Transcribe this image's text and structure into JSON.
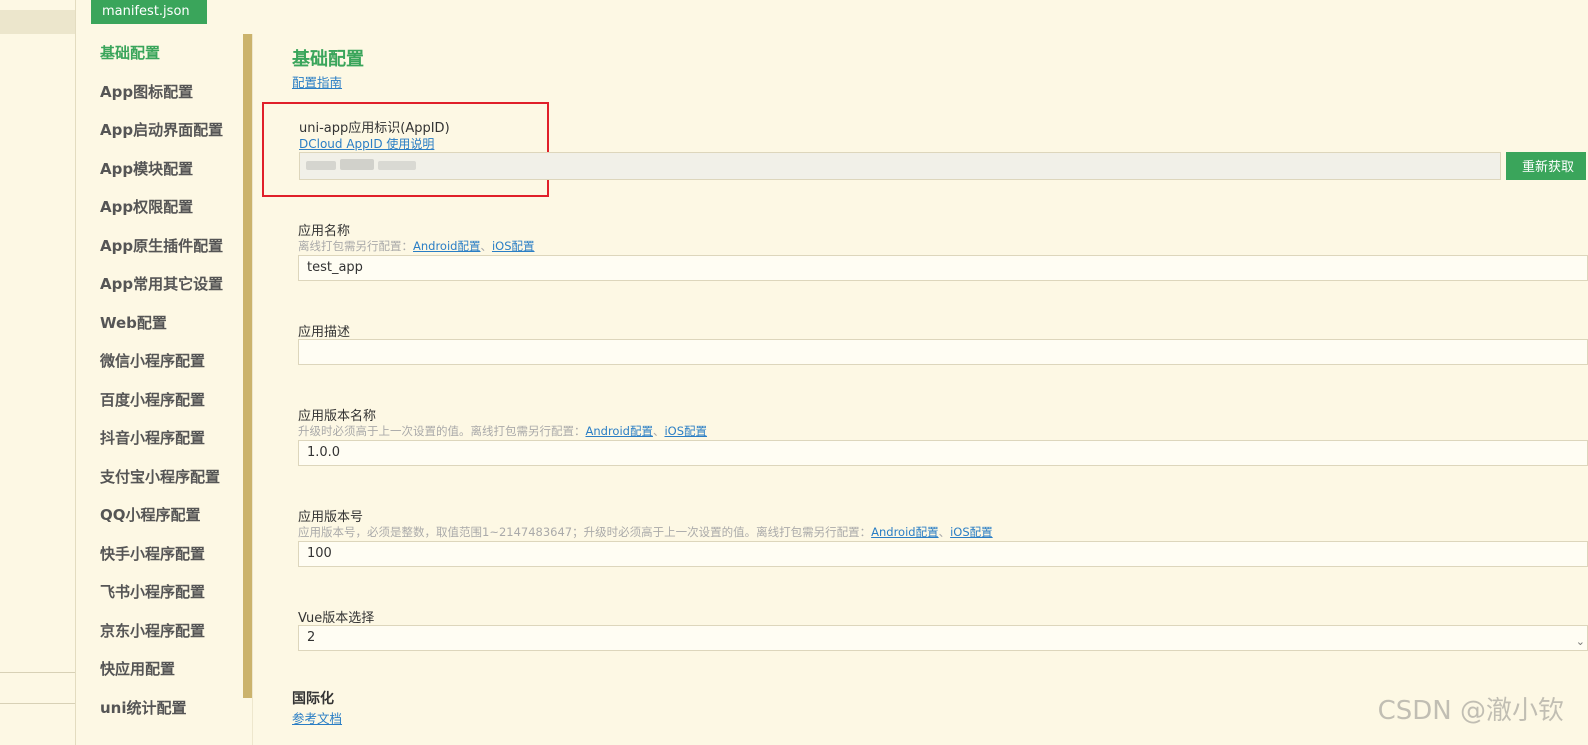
{
  "tab": {
    "label": "manifest.json"
  },
  "nav": {
    "items": [
      "基础配置",
      "App图标配置",
      "App启动界面配置",
      "App模块配置",
      "App权限配置",
      "App原生插件配置",
      "App常用其它设置",
      "Web配置",
      "微信小程序配置",
      "百度小程序配置",
      "抖音小程序配置",
      "支付宝小程序配置",
      "QQ小程序配置",
      "快手小程序配置",
      "飞书小程序配置",
      "京东小程序配置",
      "快应用配置",
      "uni统计配置"
    ]
  },
  "section": {
    "title": "基础配置",
    "guide_link": "配置指南"
  },
  "appid": {
    "label": "uni-app应用标识(AppID)",
    "doc_link": "DCloud AppID 使用说明",
    "refetch_button": "重新获取"
  },
  "app_name": {
    "label": "应用名称",
    "hint": "离线打包需另行配置：",
    "android_link": "Android配置",
    "sep": "、",
    "ios_link": "iOS配置",
    "value": "test_app"
  },
  "app_desc": {
    "label": "应用描述",
    "value": ""
  },
  "version_name": {
    "label": "应用版本名称",
    "hint": "升级时必须高于上一次设置的值。离线打包需另行配置：",
    "android_link": "Android配置",
    "sep": "、",
    "ios_link": "iOS配置",
    "value": "1.0.0"
  },
  "version_code": {
    "label": "应用版本号",
    "hint": "应用版本号，必须是整数，取值范围1~2147483647；升级时必须高于上一次设置的值。离线打包需另行配置：",
    "android_link": "Android配置",
    "sep": "、",
    "ios_link": "iOS配置",
    "value": "100"
  },
  "vue_version": {
    "label": "Vue版本选择",
    "value": "2"
  },
  "i18n": {
    "title": "国际化",
    "doc_link": "参考文档"
  },
  "watermark": "CSDN @澈小钦",
  "colors": {
    "accent": "#3aa55b",
    "link": "#2a7ec5",
    "highlight": "#e0202a",
    "background": "#fdf8e4"
  }
}
